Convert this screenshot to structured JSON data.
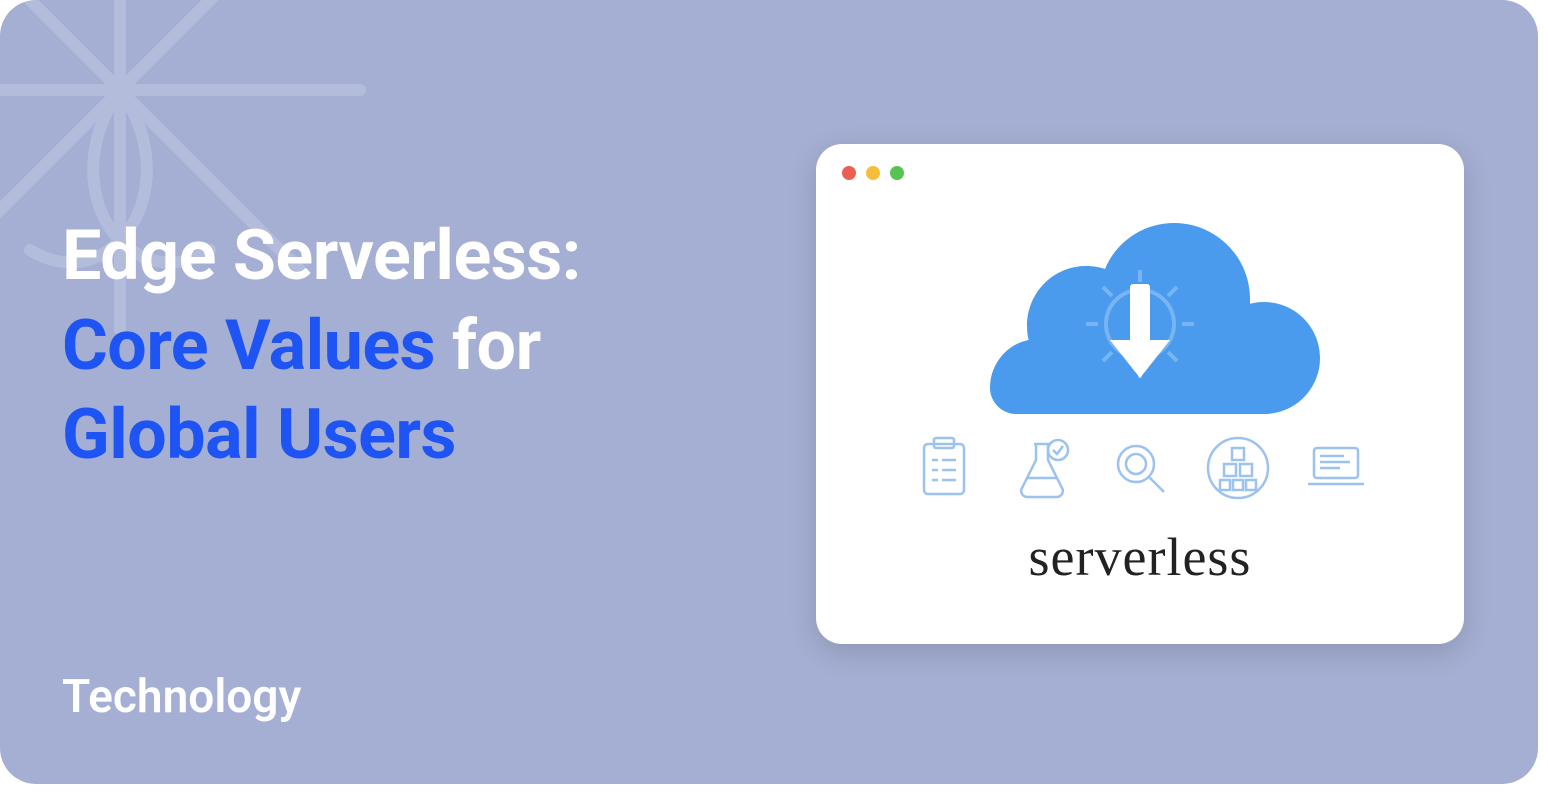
{
  "title": {
    "line1_white": "Edge Serverless:",
    "line2_blue": "Core Values",
    "line2_white": " for",
    "line3_blue": "Global Users"
  },
  "category": "Technology",
  "card": {
    "label": "serverless",
    "icons": [
      "clipboard-icon",
      "flask-icon",
      "magnifier-icon",
      "stack-icon",
      "laptop-icon"
    ],
    "dots": [
      "red",
      "amber",
      "green"
    ]
  },
  "colors": {
    "bg": "#a4afd3",
    "accent": "#1f54f4",
    "cloud": "#4a9bed"
  }
}
